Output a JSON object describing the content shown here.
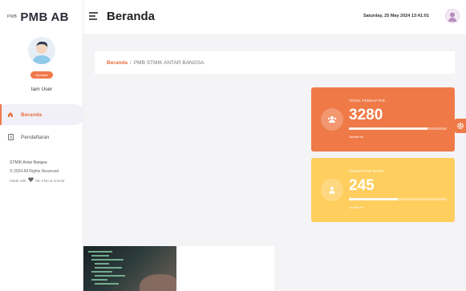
{
  "brand": {
    "mark": "PMB",
    "title": "PMB AB"
  },
  "user": {
    "role": "Operator",
    "name": "Iam User"
  },
  "nav": [
    {
      "label": "Beranda",
      "icon": "home-icon",
      "active": true
    },
    {
      "label": "Pendaftaran",
      "icon": "document-icon",
      "active": false
    }
  ],
  "footer": {
    "org": "STMIK Antar Bangsa",
    "copyright": "© 2024 All Rights Reserved",
    "made_prefix": "Made with",
    "made_suffix": "AB, Irfan & Ammar"
  },
  "header": {
    "title": "Beranda",
    "datetime": "Saturday, 25 May 2024  13:41:01"
  },
  "breadcrumb": {
    "home": "Beranda",
    "separator": "/",
    "current": "PMB STMIK ANTAR BANGSA"
  },
  "stats": [
    {
      "label": "TOTAL PENDAFTAR",
      "value": "3280",
      "sub": "Jumlah ini",
      "progress": 0.8,
      "color": "#ef7a48"
    },
    {
      "label": "PENDAFTAR BARU",
      "value": "245",
      "sub": "Jumlah ini",
      "progress": 0.5,
      "color": "#fece5e"
    }
  ],
  "colors": {
    "accent": "#f0794b",
    "warning": "#fece5e"
  }
}
